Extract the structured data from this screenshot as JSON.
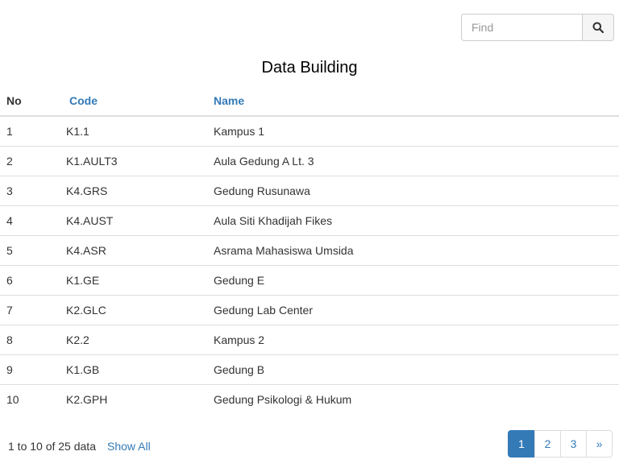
{
  "search": {
    "placeholder": "Find",
    "button_icon": "search-icon"
  },
  "title": "Data Building",
  "table": {
    "headers": {
      "no": "No",
      "code": "Code",
      "name": "Name"
    },
    "rows": [
      {
        "no": "1",
        "code": "K1.1",
        "name": "Kampus 1"
      },
      {
        "no": "2",
        "code": "K1.AULT3",
        "name": "Aula Gedung A Lt. 3"
      },
      {
        "no": "3",
        "code": "K4.GRS",
        "name": "Gedung Rusunawa"
      },
      {
        "no": "4",
        "code": "K4.AUST",
        "name": "Aula Siti Khadijah Fikes"
      },
      {
        "no": "5",
        "code": "K4.ASR",
        "name": "Asrama Mahasiswa Umsida"
      },
      {
        "no": "6",
        "code": "K1.GE",
        "name": "Gedung E"
      },
      {
        "no": "7",
        "code": "K2.GLC",
        "name": "Gedung Lab Center"
      },
      {
        "no": "8",
        "code": "K2.2",
        "name": "Kampus 2"
      },
      {
        "no": "9",
        "code": "K1.GB",
        "name": "Gedung B"
      },
      {
        "no": "10",
        "code": "K2.GPH",
        "name": "Gedung Psikologi & Hukum"
      }
    ]
  },
  "footer": {
    "info": "1 to 10 of 25 data",
    "show_all": "Show All"
  },
  "pagination": {
    "pages": [
      "1",
      "2",
      "3"
    ],
    "next": "»",
    "active_page": "1"
  },
  "colors": {
    "link": "#337ab7",
    "active_page_bg": "#337ab7",
    "border": "#dddddd"
  }
}
